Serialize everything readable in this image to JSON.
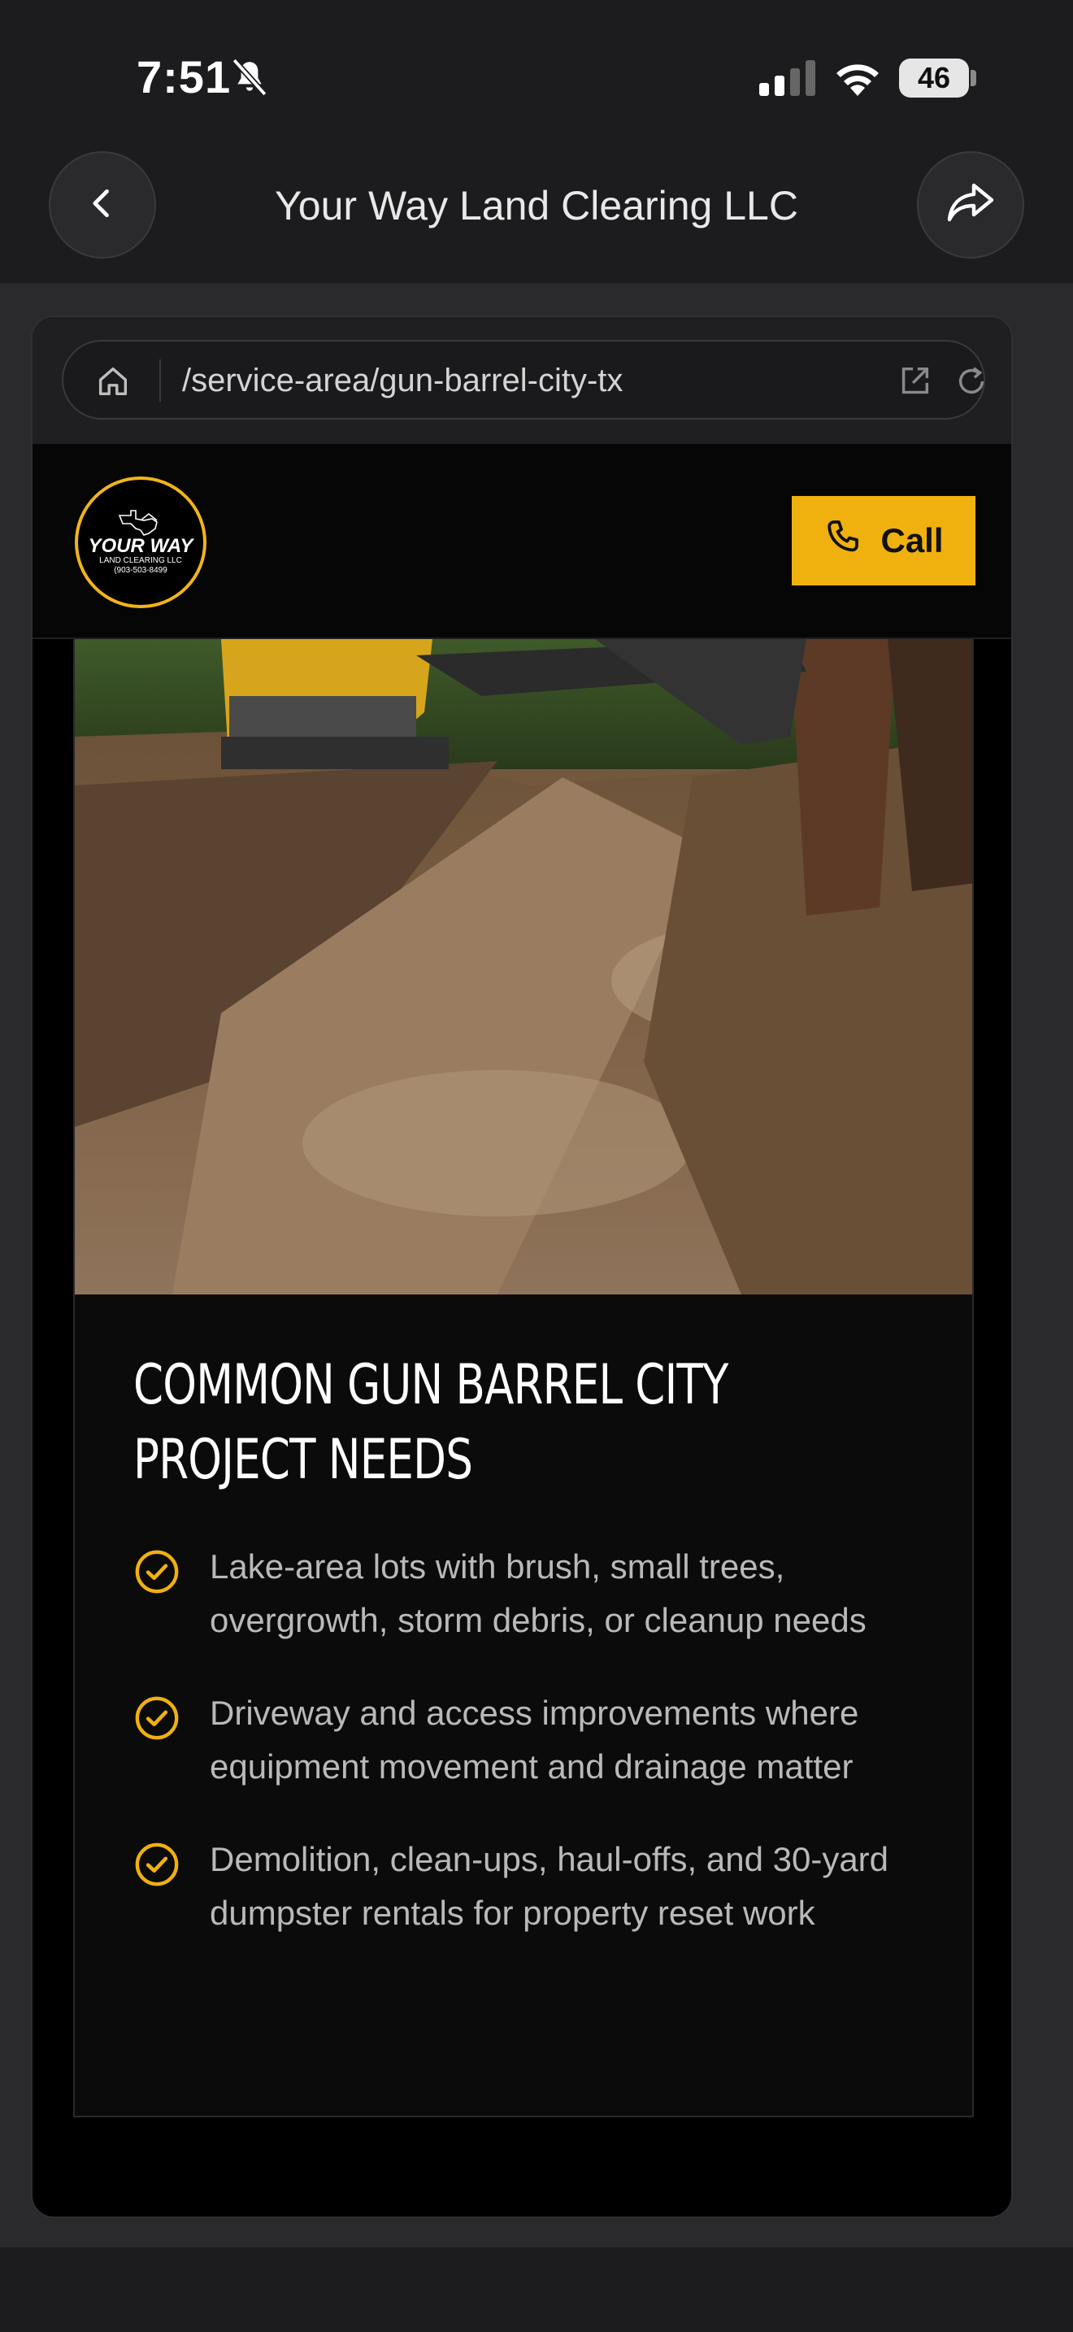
{
  "status_bar": {
    "time": "7:51",
    "battery": "46",
    "icons": [
      "bell-slash-icon",
      "signal-icon",
      "wifi-icon",
      "battery-icon"
    ]
  },
  "nav": {
    "title": "Your Way Land Clearing LLC",
    "back_icon": "chevron-left-icon",
    "share_icon": "share-icon"
  },
  "browser": {
    "url": "/service-area/gun-barrel-city-tx",
    "icons": [
      "home-icon",
      "external-link-icon",
      "reload-icon"
    ]
  },
  "site": {
    "logo": {
      "title": "YOUR WAY",
      "subtitle": "LAND CLEARING LLC",
      "phone": "(903-503-8499"
    },
    "call_label": "Call",
    "accent_color": "#f0b10f"
  },
  "section": {
    "title": "COMMON GUN BARREL CITY PROJECT NEEDS",
    "items": [
      {
        "text": "Lake-area lots with brush, small trees, overgrowth, storm debris, or cleanup needs"
      },
      {
        "text": "Driveway and access improvements where equipment movement and drainage matter"
      },
      {
        "text": "Demolition, clean-ups, haul-offs, and 30-yard dumpster rentals for property reset work"
      }
    ]
  }
}
